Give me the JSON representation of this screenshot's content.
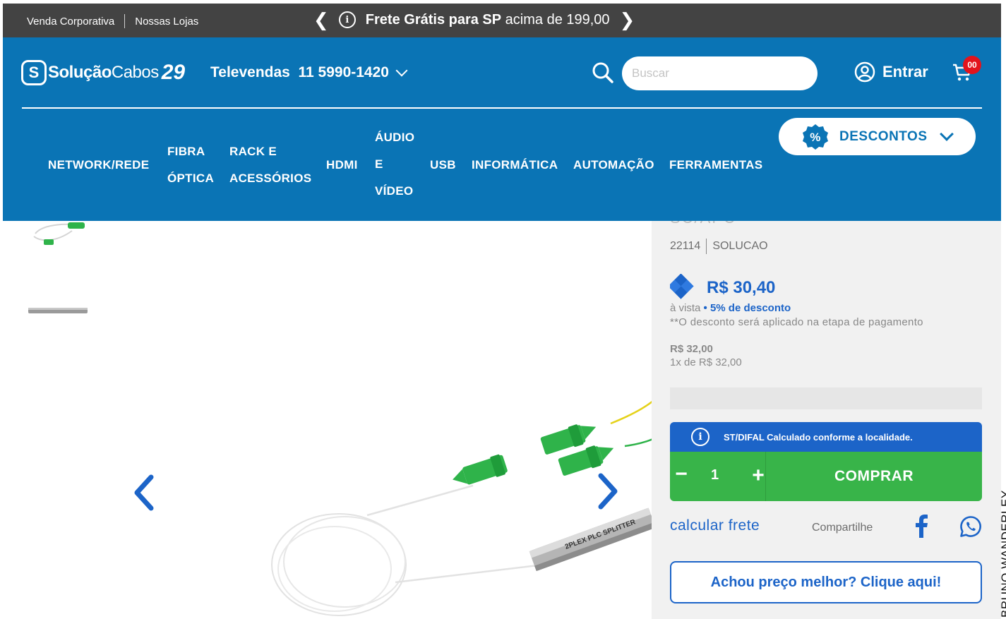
{
  "topbar": {
    "link_corporate": "Venda Corporativa",
    "link_stores": "Nossas Lojas",
    "promo_bold": "Frete Grátis para SP",
    "promo_rest": " acima de 199,00"
  },
  "header": {
    "logo_brand_a": "Solução",
    "logo_brand_b": "Cabos",
    "logo_anniversary": "29",
    "televendas": "Televendas  11 5990-1420",
    "search_placeholder": "Buscar",
    "login_label": "Entrar",
    "cart_count": "00"
  },
  "nav": {
    "items": [
      {
        "line1": "NETWORK/REDE"
      },
      {
        "line1": "FIBRA",
        "line2": "ÓPTICA"
      },
      {
        "line1": "RACK E",
        "line2": "ACESSÓRIOS"
      },
      {
        "line1": "HDMI"
      },
      {
        "line1": "ÁUDIO",
        "line2": "E",
        "line3": "VÍDEO"
      },
      {
        "line1": "USB"
      },
      {
        "line1": "INFORMÁTICA"
      },
      {
        "line1": "AUTOMAÇÃO"
      },
      {
        "line1": "FERRAMENTAS"
      }
    ],
    "descontos": "DESCONTOS"
  },
  "product": {
    "title_fragment": "SC/APC",
    "sku": "22114",
    "brand": "SOLUCAO",
    "price": "R$ 30,40",
    "avista": "à vista ",
    "discount": "• 5% de desconto",
    "note": "**O desconto será aplicado na etapa de pagamento",
    "old_price": "R$ 32,00",
    "installment": "1x de R$ 32,00",
    "image_label": "2PLEX PLC SPLITTER",
    "st_notice": "ST/DIFAL Calculado conforme a localidade.",
    "quantity": "1",
    "qty_minus": "−",
    "qty_plus": "+",
    "buy_label": "COMPRAR",
    "shipping_link": "calcular frete",
    "share_label": "Compartilhe",
    "better_price": "Achou preço melhor? Clique aqui!"
  },
  "credit": "BRUNO WANDERLEY",
  "colors": {
    "topbar": "#434343",
    "header": "#0a74b5",
    "accent_blue": "#1c64c8",
    "buy_green": "#38b449",
    "badge_red": "#e3141d"
  },
  "icons": [
    "info-icon",
    "chevron-left-icon",
    "chevron-right-icon",
    "search-icon",
    "user-icon",
    "cart-icon",
    "percent-badge-icon",
    "diamond-pix-icon",
    "facebook-icon",
    "whatsapp-icon"
  ]
}
